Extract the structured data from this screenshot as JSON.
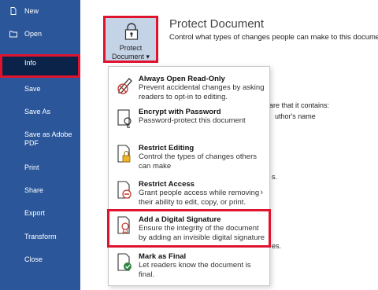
{
  "sidebar": {
    "items": [
      {
        "label": "New"
      },
      {
        "label": "Open"
      },
      {
        "label": "Info"
      },
      {
        "label": "Save"
      },
      {
        "label": "Save As"
      },
      {
        "label": "Save as Adobe PDF"
      },
      {
        "label": "Print"
      },
      {
        "label": "Share"
      },
      {
        "label": "Export"
      },
      {
        "label": "Transform"
      },
      {
        "label": "Close"
      }
    ]
  },
  "protect": {
    "button_line1": "Protect",
    "button_line2": "Document ▾",
    "title": "Protect Document",
    "description": "Control what types of changes people can make to this document."
  },
  "background_text": {
    "line1": "are that it contains:",
    "line2": "uthor's name",
    "line3": "s.",
    "line4": "es."
  },
  "menu": {
    "items": [
      {
        "title": "Always Open Read-Only",
        "description": "Prevent accidental changes by asking readers to opt-in to editing.",
        "icon": "pencil-no-icon"
      },
      {
        "title": "Encrypt with Password",
        "description": "Password-protect this document",
        "icon": "lock-icon"
      },
      {
        "title": "Restrict Editing",
        "description": "Control the types of changes others can make",
        "icon": "restrict-editing-icon"
      },
      {
        "title": "Restrict Access",
        "description": "Grant people access while removing their ability to edit, copy, or print.",
        "icon": "restrict-access-icon"
      },
      {
        "title": "Add a Digital Signature",
        "description": "Ensure the integrity of the document by adding an invisible digital signature",
        "icon": "digital-signature-icon"
      },
      {
        "title": "Mark as Final",
        "description": "Let readers know the document is final.",
        "icon": "mark-final-icon"
      }
    ]
  },
  "colors": {
    "sidebar": "#2b579a",
    "selected": "#0b2349",
    "highlight": "#e0132f"
  }
}
